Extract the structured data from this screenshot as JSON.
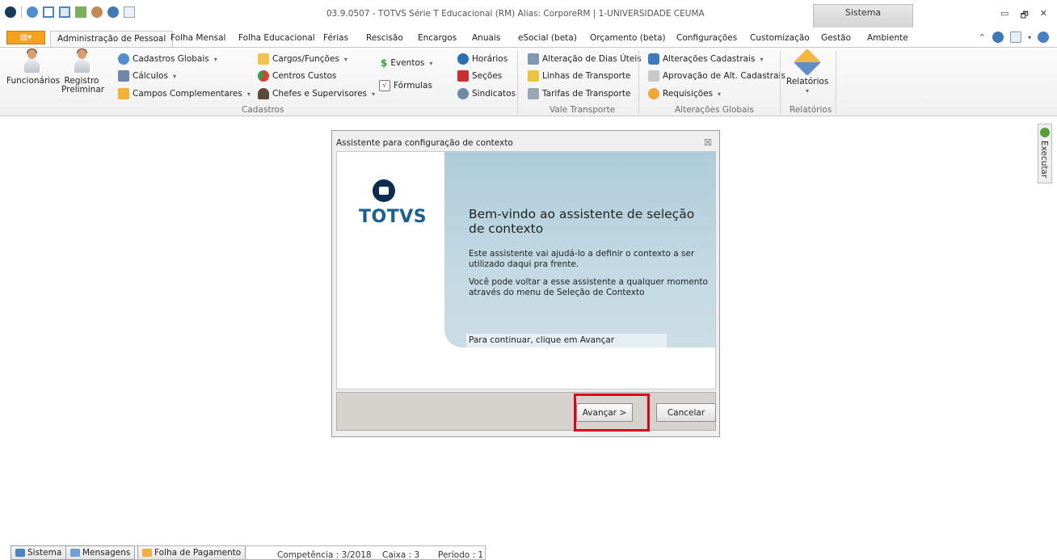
{
  "window": {
    "title": "03.9.0507 - TOTVS Série T Educacional (RM) Alias: CorporeRM | 1-UNIVERSIDADE CEUMA",
    "context_tab": "Sistema",
    "controls": {
      "minimize": "▭",
      "restore": "🗗",
      "close": "✕"
    }
  },
  "tabs": [
    {
      "label": "Administração de Pessoal"
    },
    {
      "label": "Folha Mensal"
    },
    {
      "label": "Folha Educacional"
    },
    {
      "label": "Férias"
    },
    {
      "label": "Rescisão"
    },
    {
      "label": "Encargos"
    },
    {
      "label": "Anuais"
    },
    {
      "label": "eSocial (beta)"
    },
    {
      "label": "Orçamento (beta)"
    },
    {
      "label": "Configurações"
    },
    {
      "label": "Customização"
    },
    {
      "label": "Gestão"
    },
    {
      "label": "Ambiente"
    }
  ],
  "ribbon": {
    "funcionarios": "Funcionários",
    "registro_1": "Registro",
    "registro_2": "Preliminar",
    "cadastros_globais": "Cadastros Globais",
    "calculos": "Cálculos",
    "campos_complementares": "Campos Complementares",
    "cargos_funcoes": "Cargos/Funções",
    "centros_custos": "Centros Custos",
    "chefes_supervisores": "Chefes e Supervisores",
    "eventos": "Eventos",
    "formulas": "Fórmulas",
    "horarios": "Horários",
    "secoes": "Seções",
    "sindicatos": "Sindicatos",
    "alteracao_dias_uteis": "Alteração de Dias Úteis",
    "linhas_transporte": "Linhas de Transporte",
    "tarifas_transporte": "Tarifas de Transporte",
    "alteracoes_cadastrais": "Alterações Cadastrais",
    "aprovacao_alt_cadastrais": "Aprovação de Alt. Cadastrais",
    "requisicoes": "Requisições",
    "relatorios_btn": "Relatórios",
    "group_cadastros": "Cadastros",
    "group_vale_transporte": "Vale Transporte",
    "group_alteracoes_globais": "Alterações Globais",
    "group_relatorios": "Relatórios"
  },
  "side_panel": {
    "executar": "Executar"
  },
  "dialog": {
    "title": "Assistente para configuração de contexto",
    "logo_text": "TOTVS",
    "heading": "Bem-vindo ao assistente de seleção de contexto",
    "para1": "Este assistente vai ajudá-lo a definir o contexto a ser utilizado daqui pra frente.",
    "para2": "Você pode voltar a esse assistente a qualquer momento através do menu de Seleção de Contexto",
    "continue_hint": "Para continuar, clique em Avançar",
    "next_button": "Avançar >",
    "cancel_button": "Cancelar"
  },
  "statusbar": {
    "sistema": "Sistema",
    "mensagens": "Mensagens",
    "folha": "Folha de Pagamento",
    "competencia": "Competência : 3/2018",
    "caixa": "Caixa : 3",
    "periodo": "Período : 1"
  },
  "colors": {
    "accent_orange": "#f4a21a",
    "totvs_blue": "#1a5e93",
    "highlight_red": "#e0001b",
    "panel_blue": "#aeccd9"
  }
}
